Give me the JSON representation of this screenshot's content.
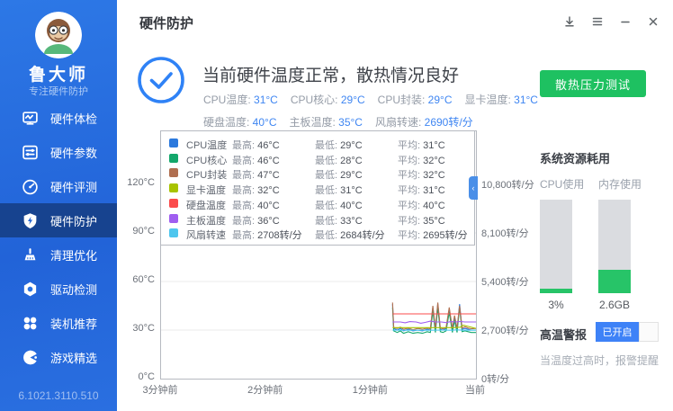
{
  "window": {
    "title": "硬件防护",
    "controls": [
      {
        "icon": "download-icon"
      },
      {
        "icon": "menu-icon"
      },
      {
        "icon": "minimize-icon"
      },
      {
        "icon": "close-icon"
      }
    ]
  },
  "sidebar": {
    "app_name": "鲁大师",
    "tagline": "专注硬件防护",
    "version": "6.1021.3110.510",
    "items": [
      {
        "id": "tijian",
        "label": "硬件体检",
        "icon": "monitor-pulse-icon",
        "active": false
      },
      {
        "id": "canshu",
        "label": "硬件参数",
        "icon": "sliders-icon",
        "active": false
      },
      {
        "id": "pingce",
        "label": "硬件评测",
        "icon": "gauge-icon",
        "active": false
      },
      {
        "id": "fanghu",
        "label": "硬件防护",
        "icon": "shield-bolt-icon",
        "active": true
      },
      {
        "id": "qingli",
        "label": "清理优化",
        "icon": "broom-icon",
        "active": false
      },
      {
        "id": "qudong",
        "label": "驱动检测",
        "icon": "nut-icon",
        "active": false
      },
      {
        "id": "zhuangji",
        "label": "装机推荐",
        "icon": "clover-icon",
        "active": false
      },
      {
        "id": "youxi",
        "label": "游戏精选",
        "icon": "pacman-icon",
        "active": false
      }
    ]
  },
  "status": {
    "headline": "当前硬件温度正常，散热情况良好",
    "metric_rows": [
      [
        {
          "label": "CPU温度:",
          "value": "31°C"
        },
        {
          "label": "CPU核心:",
          "value": "29°C"
        },
        {
          "label": "CPU封装:",
          "value": "29°C"
        },
        {
          "label": "显卡温度:",
          "value": "31°C"
        }
      ],
      [
        {
          "label": "硬盘温度:",
          "value": "40°C"
        },
        {
          "label": "主板温度:",
          "value": "35°C"
        },
        {
          "label": "风扇转速:",
          "value": "2690转/分"
        }
      ]
    ]
  },
  "chart_data": {
    "type": "line",
    "x_axis": {
      "labels": [
        "3分钟前",
        "2分钟前",
        "1分钟前",
        "当前"
      ]
    },
    "y_left": {
      "labels": [
        "0°C",
        "30°C",
        "60°C",
        "90°C",
        "120°C"
      ],
      "ylim": [
        0,
        153
      ],
      "unit": "°C"
    },
    "y_right": {
      "labels": [
        "0转/分",
        "2,700转/分",
        "5,400转/分",
        "8,100转/分",
        "10,800转/分"
      ],
      "ylim": [
        0,
        13750
      ],
      "unit": "转/分"
    },
    "legend_columns": [
      "最高:",
      "最低:",
      "平均:"
    ],
    "collapse_glyph": "‹",
    "grid": true,
    "legend_position": "top-inside",
    "series": [
      {
        "name": "CPU温度",
        "color": "#2b79dd",
        "axis": "temp",
        "max": "46°C",
        "min": "29°C",
        "avg": "31°C",
        "points": [
          [
            0.735,
            46
          ],
          [
            0.739,
            31
          ],
          [
            0.75,
            30
          ],
          [
            0.76,
            31
          ],
          [
            0.77,
            29.5
          ],
          [
            0.785,
            30.5
          ],
          [
            0.8,
            29.5
          ],
          [
            0.815,
            30
          ],
          [
            0.83,
            29.5
          ],
          [
            0.845,
            30.5
          ],
          [
            0.855,
            30
          ],
          [
            0.863,
            44
          ],
          [
            0.871,
            30
          ],
          [
            0.879,
            46
          ],
          [
            0.887,
            30.5
          ],
          [
            0.895,
            30
          ],
          [
            0.905,
            31
          ],
          [
            0.915,
            43
          ],
          [
            0.925,
            30
          ],
          [
            0.932,
            38
          ],
          [
            0.94,
            30
          ],
          [
            0.948,
            46
          ],
          [
            0.956,
            30.5
          ],
          [
            0.965,
            31
          ],
          [
            0.975,
            30.5
          ],
          [
            0.985,
            30
          ],
          [
            1.0,
            30
          ]
        ]
      },
      {
        "name": "CPU核心",
        "color": "#13a76b",
        "axis": "temp",
        "max": "46°C",
        "min": "28°C",
        "avg": "32°C",
        "points": [
          [
            0.735,
            44
          ],
          [
            0.739,
            29.5
          ],
          [
            0.75,
            28.5
          ],
          [
            0.76,
            29.5
          ],
          [
            0.77,
            28
          ],
          [
            0.785,
            29
          ],
          [
            0.8,
            28
          ],
          [
            0.815,
            28.5
          ],
          [
            0.83,
            28
          ],
          [
            0.845,
            29
          ],
          [
            0.855,
            28.5
          ],
          [
            0.863,
            42
          ],
          [
            0.871,
            28.5
          ],
          [
            0.879,
            44
          ],
          [
            0.887,
            29
          ],
          [
            0.895,
            28.5
          ],
          [
            0.905,
            29.5
          ],
          [
            0.915,
            41
          ],
          [
            0.925,
            28.5
          ],
          [
            0.932,
            36
          ],
          [
            0.94,
            28.5
          ],
          [
            0.948,
            44
          ],
          [
            0.956,
            29
          ],
          [
            0.965,
            29.5
          ],
          [
            0.975,
            29
          ],
          [
            0.985,
            28.5
          ],
          [
            1.0,
            28.5
          ]
        ]
      },
      {
        "name": "CPU封装",
        "color": "#b06f50",
        "axis": "temp",
        "max": "47°C",
        "min": "29°C",
        "avg": "32°C",
        "points": [
          [
            0.735,
            47
          ],
          [
            0.739,
            31.5
          ],
          [
            0.75,
            31
          ],
          [
            0.76,
            31.8
          ],
          [
            0.77,
            30.5
          ],
          [
            0.785,
            31.2
          ],
          [
            0.8,
            30.2
          ],
          [
            0.815,
            31
          ],
          [
            0.83,
            30.5
          ],
          [
            0.845,
            31.2
          ],
          [
            0.855,
            30.8
          ],
          [
            0.863,
            45
          ],
          [
            0.871,
            31
          ],
          [
            0.879,
            47
          ],
          [
            0.887,
            31.2
          ],
          [
            0.895,
            30.8
          ],
          [
            0.905,
            31.5
          ],
          [
            0.915,
            44
          ],
          [
            0.925,
            31
          ],
          [
            0.932,
            39
          ],
          [
            0.94,
            31
          ],
          [
            0.948,
            45
          ],
          [
            0.956,
            31.2
          ],
          [
            0.965,
            32
          ],
          [
            0.975,
            31.2
          ],
          [
            0.985,
            30.8
          ],
          [
            1.0,
            31
          ]
        ]
      },
      {
        "name": "显卡温度",
        "color": "#a8c300",
        "axis": "temp",
        "max": "32°C",
        "min": "31°C",
        "avg": "31°C",
        "points": [
          [
            0.735,
            31.5
          ],
          [
            0.8,
            31.5
          ],
          [
            0.87,
            31.5
          ],
          [
            0.93,
            31.5
          ],
          [
            0.95,
            31.8
          ],
          [
            0.96,
            33
          ],
          [
            0.975,
            32.3
          ],
          [
            0.99,
            31.5
          ],
          [
            1.0,
            31
          ]
        ]
      },
      {
        "name": "硬盘温度",
        "color": "#fb4b4b",
        "axis": "temp",
        "max": "40°C",
        "min": "40°C",
        "avg": "40°C",
        "points": [
          [
            0.735,
            40
          ],
          [
            1.0,
            40
          ]
        ]
      },
      {
        "name": "主板温度",
        "color": "#9f5ef0",
        "axis": "temp",
        "max": "36°C",
        "min": "33°C",
        "avg": "35°C",
        "points": [
          [
            0.735,
            35
          ],
          [
            0.76,
            35
          ],
          [
            0.775,
            34.5
          ],
          [
            0.79,
            35.2
          ],
          [
            0.81,
            35
          ],
          [
            0.825,
            34.2
          ],
          [
            0.84,
            34.8
          ],
          [
            0.855,
            35.5
          ],
          [
            0.87,
            35
          ],
          [
            0.89,
            35
          ],
          [
            0.905,
            34.6
          ],
          [
            0.92,
            35.2
          ],
          [
            0.935,
            35
          ],
          [
            0.95,
            35.3
          ],
          [
            0.965,
            35
          ],
          [
            0.98,
            35
          ],
          [
            1.0,
            35
          ]
        ]
      },
      {
        "name": "风扇转速",
        "color": "#4ec6ee",
        "axis": "fan",
        "max": "2708转/分",
        "min": "2684转/分",
        "avg": "2695转/分",
        "points": [
          [
            0.735,
            2695
          ],
          [
            0.77,
            2690
          ],
          [
            0.8,
            2688
          ],
          [
            0.83,
            2692
          ],
          [
            0.86,
            2690
          ],
          [
            0.89,
            2700
          ],
          [
            0.92,
            2688
          ],
          [
            0.94,
            2708
          ],
          [
            0.96,
            2690
          ],
          [
            0.98,
            2695
          ],
          [
            1.0,
            2690
          ]
        ]
      }
    ]
  },
  "side_panel": {
    "stress_test_button": "散热压力测试",
    "resources": {
      "title": "系统资源耗用",
      "gauges": [
        {
          "label": "CPU使用",
          "value": "3%",
          "fill_percent": 5
        },
        {
          "label": "内存使用",
          "value": "2.6GB",
          "fill_percent": 25
        }
      ]
    },
    "alarm": {
      "title": "高温警报",
      "toggle_label": "已开启",
      "enabled": true,
      "description": "当温度过高时，报警提醒"
    }
  }
}
